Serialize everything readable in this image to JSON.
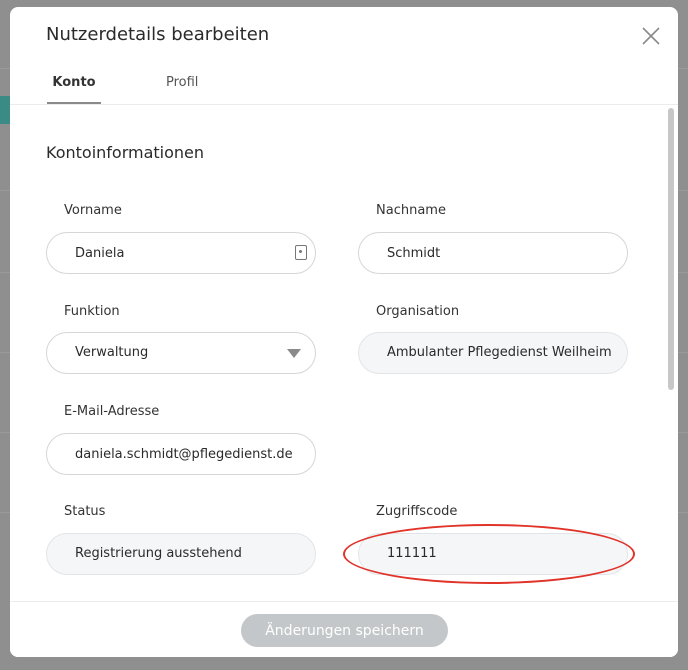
{
  "modal": {
    "title": "Nutzerdetails bearbeiten"
  },
  "tabs": [
    {
      "label": "Konto",
      "active": true
    },
    {
      "label": "Profil",
      "active": false
    }
  ],
  "section": {
    "title": "Kontoinformationen"
  },
  "fields": {
    "vorname": {
      "label": "Vorname",
      "value": "Daniela"
    },
    "nachname": {
      "label": "Nachname",
      "value": "Schmidt"
    },
    "funktion": {
      "label": "Funktion",
      "value": "Verwaltung"
    },
    "organisation": {
      "label": "Organisation",
      "value": "Ambulanter Pflegedienst Weilheim"
    },
    "email": {
      "label": "E-Mail-Adresse",
      "value": "daniela.schmidt@pflegedienst.de"
    },
    "status": {
      "label": "Status",
      "value": "Registrierung ausstehend"
    },
    "zugriffscode": {
      "label": "Zugriffscode",
      "value": "111111"
    }
  },
  "footer": {
    "save_label": "Änderungen speichern"
  },
  "colors": {
    "highlight": "#e0332a",
    "button_disabled": "#c4c7c9",
    "accent": "#3a8a86"
  },
  "icons": {
    "close": "close-icon",
    "contact_card": "contact-card-icon",
    "dropdown": "chevron-down-icon"
  }
}
